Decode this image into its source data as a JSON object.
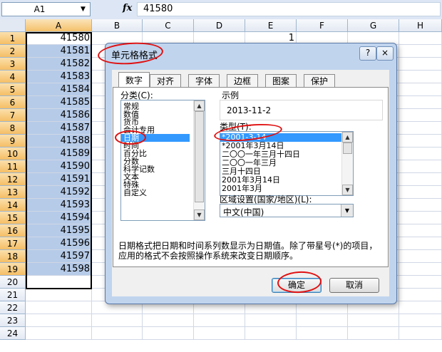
{
  "formula_bar": {
    "name_box": "A1",
    "fx_label": "fx",
    "content": "41580"
  },
  "columns": [
    "A",
    "B",
    "C",
    "D",
    "E",
    "F",
    "G",
    "H"
  ],
  "rows": [
    {
      "num": "1",
      "a": "41580",
      "e": "1"
    },
    {
      "num": "2",
      "a": "41581"
    },
    {
      "num": "3",
      "a": "41582"
    },
    {
      "num": "4",
      "a": "41583"
    },
    {
      "num": "5",
      "a": "41584"
    },
    {
      "num": "6",
      "a": "41585"
    },
    {
      "num": "7",
      "a": "41586"
    },
    {
      "num": "8",
      "a": "41587"
    },
    {
      "num": "9",
      "a": "41588"
    },
    {
      "num": "10",
      "a": "41589"
    },
    {
      "num": "11",
      "a": "41590"
    },
    {
      "num": "12",
      "a": "41591"
    },
    {
      "num": "13",
      "a": "41592"
    },
    {
      "num": "14",
      "a": "41593"
    },
    {
      "num": "15",
      "a": "41594"
    },
    {
      "num": "16",
      "a": "41595"
    },
    {
      "num": "17",
      "a": "41596"
    },
    {
      "num": "18",
      "a": "41597"
    },
    {
      "num": "19",
      "a": "41598"
    },
    {
      "num": "20",
      "a": ""
    },
    {
      "num": "21",
      "a": ""
    },
    {
      "num": "22",
      "a": ""
    },
    {
      "num": "23",
      "a": ""
    },
    {
      "num": "24",
      "a": ""
    }
  ],
  "dialog": {
    "title": "单元格格式",
    "help_button": "?",
    "close_button": "×",
    "tabs": [
      "数字",
      "对齐",
      "字体",
      "边框",
      "图案",
      "保护"
    ],
    "active_tab": "数字",
    "category_label": "分类(C):",
    "categories": [
      "常规",
      "数值",
      "货币",
      "会计专用",
      "日期",
      "时间",
      "百分比",
      "分数",
      "科学记数",
      "文本",
      "特殊",
      "自定义"
    ],
    "selected_category": "日期",
    "sample_label": "示例",
    "sample_value": "2013-11-2",
    "type_label": "类型(T):",
    "types": [
      "*2001-3-14",
      "*2001年3月14日",
      "二〇〇一年三月十四日",
      "二〇〇一年三月",
      "三月十四日",
      "2001年3月14日",
      "2001年3月"
    ],
    "selected_type": "*2001-3-14",
    "locale_label": "区域设置(国家/地区)(L):",
    "locale_value": "中文(中国)",
    "description": "日期格式把日期和时间系列数显示为日期值。除了带星号(*)的项目，应用的格式不会按照操作系统来改变日期顺序。",
    "ok_label": "确定",
    "cancel_label": "取消"
  },
  "colors": {
    "selection": "#b6cbe8",
    "header_selected": "#f5be65",
    "list_highlight": "#3399ff",
    "annotation": "#e01010"
  }
}
